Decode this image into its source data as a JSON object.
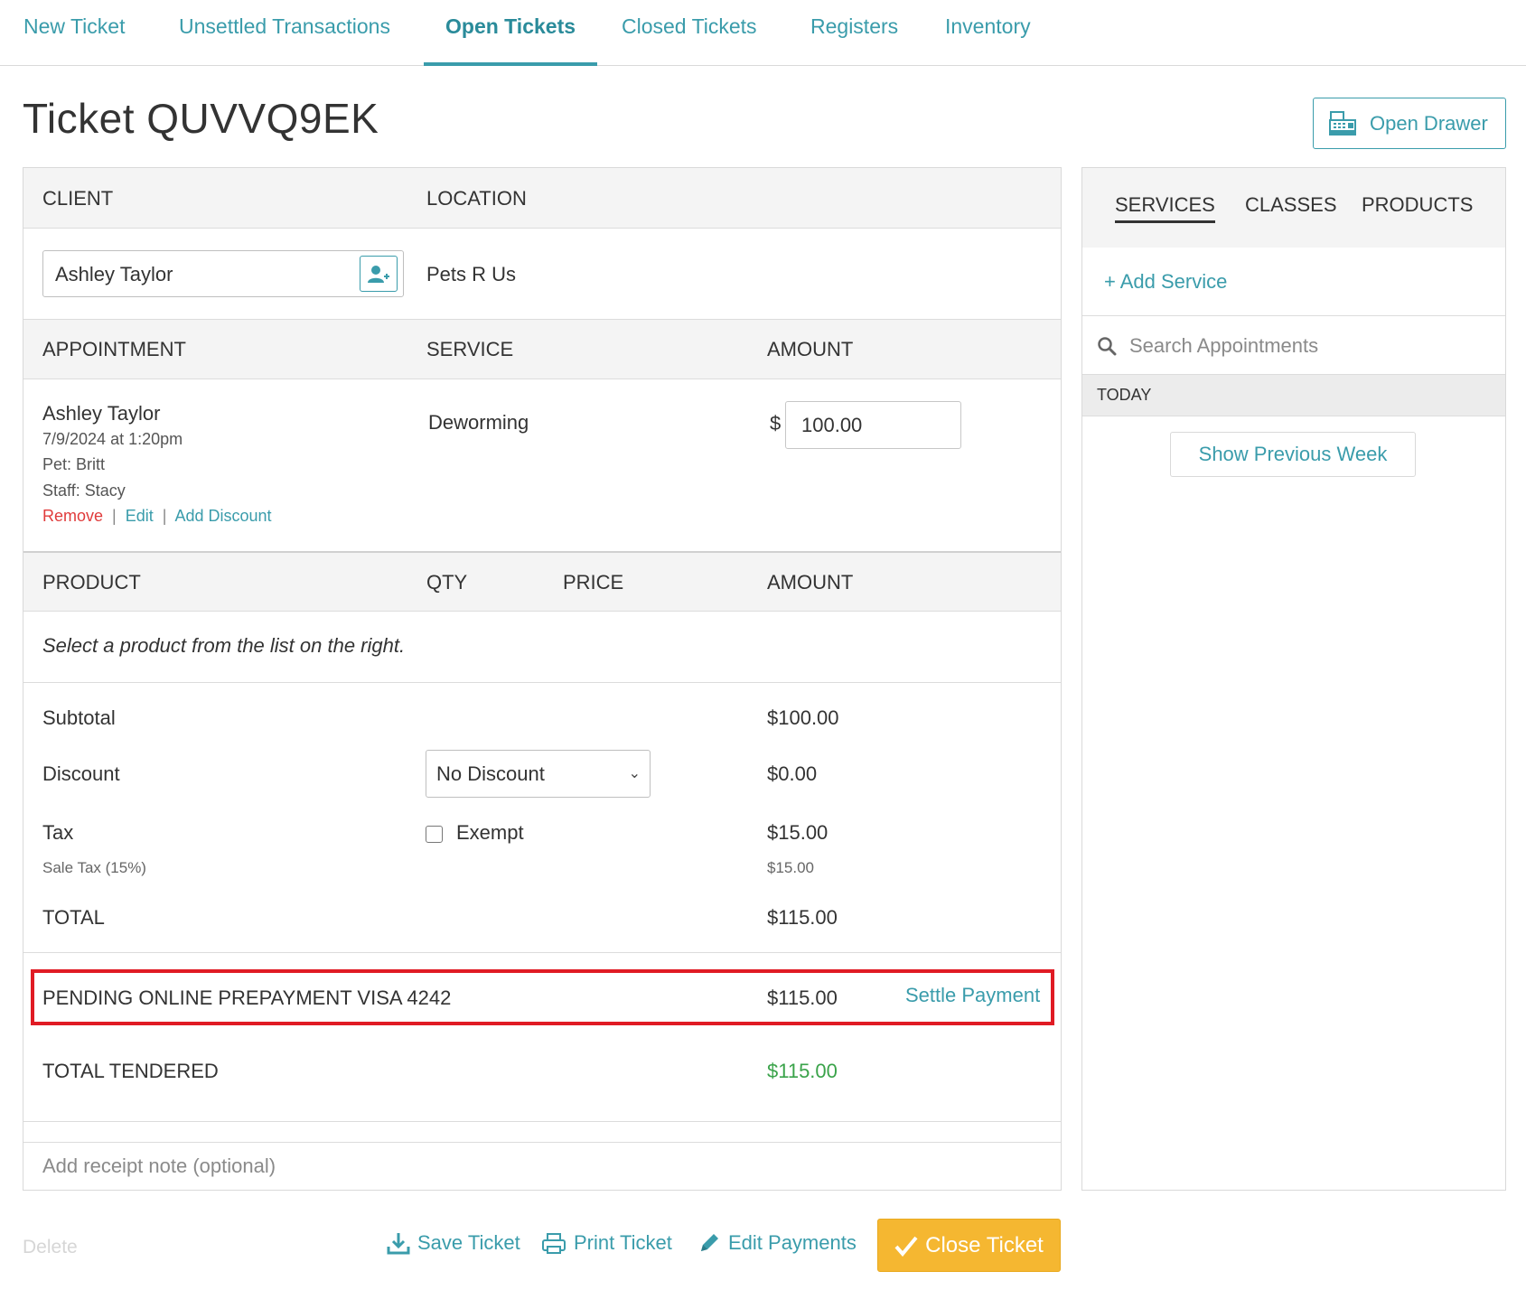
{
  "nav": {
    "tabs": [
      {
        "label": "New Ticket"
      },
      {
        "label": "Unsettled Transactions"
      },
      {
        "label": "Open Tickets"
      },
      {
        "label": "Closed Tickets"
      },
      {
        "label": "Registers"
      },
      {
        "label": "Inventory"
      }
    ],
    "active_tab": "Open Tickets"
  },
  "header": {
    "title": "Ticket QUVVQ9EK",
    "open_drawer_label": "Open Drawer"
  },
  "ticket": {
    "client_header": "CLIENT",
    "location_header": "LOCATION",
    "client_value": "Ashley Taylor",
    "location_value": "Pets R Us",
    "appointment_header": "APPOINTMENT",
    "service_header": "SERVICE",
    "amount_header": "AMOUNT",
    "appointment": {
      "client": "Ashley Taylor",
      "datetime": "7/9/2024 at 1:20pm",
      "pet": "Pet: Britt",
      "staff": "Staff: Stacy",
      "remove_label": "Remove",
      "edit_label": "Edit",
      "add_discount_label": "Add Discount",
      "service": "Deworming",
      "currency": "$",
      "amount": "100.00"
    },
    "product_header": "PRODUCT",
    "qty_header": "QTY",
    "price_header": "PRICE",
    "product_amount_header": "AMOUNT",
    "product_empty": "Select a product from the list on the right.",
    "subtotal_label": "Subtotal",
    "subtotal_value": "$100.00",
    "discount_label": "Discount",
    "discount_select": "No Discount",
    "discount_value": "$0.00",
    "tax_label": "Tax",
    "exempt_label": "Exempt",
    "tax_value": "$15.00",
    "sale_tax_label": "Sale Tax (15%)",
    "sale_tax_value": "$15.00",
    "total_label": "TOTAL",
    "total_value": "$115.00",
    "pending_label": "PENDING ONLINE PREPAYMENT VISA 4242",
    "pending_value": "$115.00",
    "settle_label": "Settle Payment",
    "tendered_label": "TOTAL TENDERED",
    "tendered_value": "$115.00",
    "note_placeholder": "Add receipt note (optional)"
  },
  "side": {
    "tabs": [
      "SERVICES",
      "CLASSES",
      "PRODUCTS"
    ],
    "active_tab": "SERVICES",
    "add_service_label": "+ Add Service",
    "search_placeholder": "Search Appointments",
    "today_label": "TODAY",
    "prev_week_label": "Show Previous Week"
  },
  "footer": {
    "delete_label": "Delete",
    "save_label": "Save Ticket",
    "print_label": "Print Ticket",
    "edit_payments_label": "Edit Payments",
    "close_label": "Close Ticket"
  },
  "colors": {
    "accent": "#3a9cab",
    "remove": "#e03b3b",
    "tendered": "#3aa34a",
    "highlight": "#e01b24",
    "close_button": "#f5b731"
  }
}
